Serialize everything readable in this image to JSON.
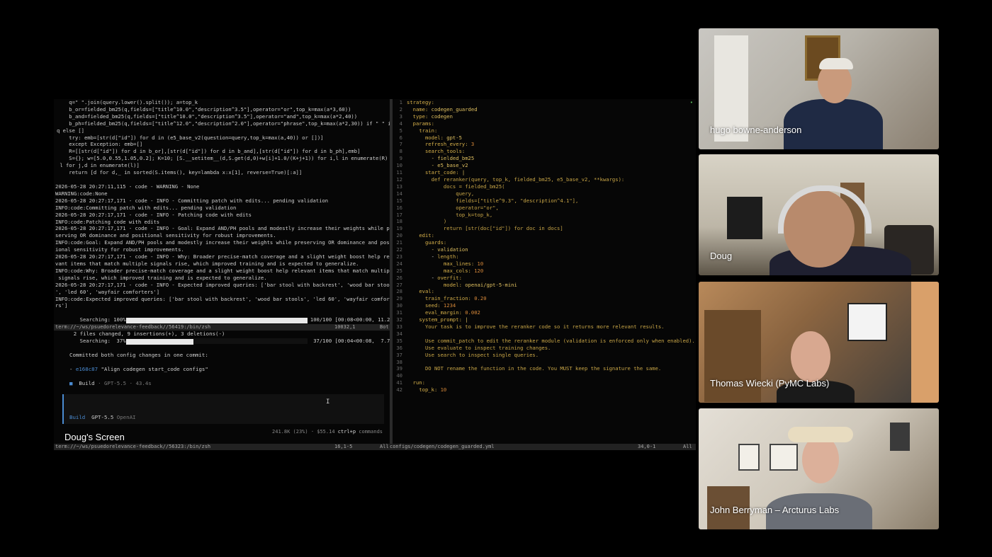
{
  "caption": "Doug's Screen",
  "left_code": [
    "    q=\" \".join(query.lower().split()); a=top_k",
    "    b_or=fielded_bm25(q,fields=[\"title^10.0\",\"description^3.5\"],operator=\"or\",top_k=max(a*3,60))",
    "    b_and=fielded_bm25(q,fields=[\"title^10.0\",\"description^3.5\"],operator=\"and\",top_k=max(a*2,40))",
    "    b_ph=fielded_bm25(q,fields=[\"title^12.0\",\"description^2.0\"],operator=\"phrase\",top_k=max(a*2,30)) if \" \" in",
    "q else []",
    "    try: emb=[str(d[\"id\"]) for d in (e5_base_v2(question=query,top_k=max(a,40)) or [])]",
    "    except Exception: emb=[]",
    "    R=[[str(d[\"id\"]) for d in b_or],[str(d[\"id\"]) for d in b_and],[str(d[\"id\"]) for d in b_ph],emb]",
    "    S={}; w=[5.0,0.55,1.05,0.2]; K=10; [S.__setitem__(d,S.get(d,0)+w[i]+1.0/(K+j+1)) for i,l in enumerate(R) if",
    " l for j,d in enumerate(l)]",
    "    return [d for d,_ in sorted(S.items(), key=lambda x:x[1], reverse=True)[:a]]"
  ],
  "log_lines": [
    "2026-05-28 20:27:11,115 - code - WARNING - None",
    "WARNING:code:None",
    "2026-05-28 20:27:17,171 - code - INFO - Committing patch with edits... pending validation",
    "INFO:code:Committing patch with edits... pending validation",
    "2026-05-28 20:27:17,171 - code - INFO - Patching code with edits",
    "INFO:code:Patching code with edits",
    "2026-05-28 20:27:17,171 - code - INFO - Goal: Expand AND/PH pools and modestly increase their weights while pre",
    "serving OR dominance and positional sensitivity for robust improvements.",
    "INFO:code:Goal: Expand AND/PH pools and modestly increase their weights while preserving OR dominance and posit",
    "ional sensitivity for robust improvements.",
    "2026-05-28 20:27:17,171 - code - INFO - Why: Broader precise-match coverage and a slight weight boost help rele",
    "vant items that match multiple signals rise, which improved training and is expected to generalize.",
    "INFO:code:Why: Broader precise-match coverage and a slight weight boost help relevant items that match multiple",
    " signals rise, which improved training and is expected to generalize.",
    "2026-05-28 20:27:17,171 - code - INFO - Expected improved queries: ['bar stool with backrest', 'wood bar stools",
    "', 'led 60', 'wayfair comforters']",
    "INFO:code:Expected improved queries: ['bar stool with backrest', 'wood bar stools', 'led 60', 'wayfair comforte",
    "rs']"
  ],
  "progress": [
    {
      "label": "Searching: 100%",
      "fraction": 1.0,
      "stats": "100/100 [00:08<00:00, 11.26it/s]"
    },
    {
      "label": "Searching:  37%",
      "fraction": 0.37,
      "stats": " 37/100 [00:04<00:08,  7.73it/s]"
    }
  ],
  "tmux_status": {
    "path": "term://~/ws/psuedorelevance-feedback//56419:/bin/zsh",
    "pos": "10032,1",
    "scroll": "Bot"
  },
  "opencode": {
    "files_changed": "    2 files changed, 9 insertions(+), 3 deletions(-)",
    "commit_msg": "Committed both config changes in one commit:",
    "commit_hash": "e168c87",
    "commit_title": "\"Align codegen start_code configs\"",
    "build_label": "Build",
    "build_model": "GPT-5.5",
    "build_time": "43.4s",
    "input_mode": "Build",
    "input_model": "GPT-5.5",
    "input_provider": "OpenAI",
    "stats": "241.8K (23%) · $55.14",
    "shortcut_key": "ctrl+p",
    "shortcut_label": "commands"
  },
  "bottom_status": {
    "left_path": "term://~/ws/psuedorelevance-feedback//56323:/bin/zsh",
    "left_pos": "16,1-5",
    "left_scroll": "All",
    "right_file": "configs/codegen/codegen_guarded.yml",
    "right_pos": "34,0-1",
    "right_scroll": "All"
  },
  "yaml_lines": [
    {
      "n": "1",
      "t": "strategy:"
    },
    {
      "n": "2",
      "t": "  name: codegen_guarded"
    },
    {
      "n": "3",
      "t": "  type: codegen"
    },
    {
      "n": "4",
      "t": "  params:"
    },
    {
      "n": "5",
      "t": "    train:"
    },
    {
      "n": "6",
      "t": "      model: gpt-5"
    },
    {
      "n": "7",
      "t": "      refresh_every: 3"
    },
    {
      "n": "8",
      "t": "      search_tools:"
    },
    {
      "n": "9",
      "t": "        - fielded_bm25"
    },
    {
      "n": "10",
      "t": "        - e5_base_v2"
    },
    {
      "n": "11",
      "t": "      start_code: |"
    },
    {
      "n": "12",
      "t": "        def reranker(query, top_k, fielded_bm25, e5_base_v2, **kwargs):"
    },
    {
      "n": "13",
      "t": "            docs = fielded_bm25("
    },
    {
      "n": "14",
      "t": "                query,"
    },
    {
      "n": "15",
      "t": "                fields=[\"title^9.3\", \"description^4.1\"],"
    },
    {
      "n": "16",
      "t": "                operator=\"or\","
    },
    {
      "n": "17",
      "t": "                top_k=top_k,"
    },
    {
      "n": "18",
      "t": "            )"
    },
    {
      "n": "19",
      "t": "            return [str(doc[\"id\"]) for doc in docs]"
    },
    {
      "n": "20",
      "t": "    edit:"
    },
    {
      "n": "21",
      "t": "      guards:"
    },
    {
      "n": "22",
      "t": "        - validation"
    },
    {
      "n": "23",
      "t": "        - length:"
    },
    {
      "n": "24",
      "t": "            max_lines: 10"
    },
    {
      "n": "25",
      "t": "            max_cols: 120"
    },
    {
      "n": "26",
      "t": "        - overfit:"
    },
    {
      "n": "27",
      "t": "            model: openai/gpt-5-mini"
    },
    {
      "n": "28",
      "t": "    eval:"
    },
    {
      "n": "29",
      "t": "      train_fraction: 0.20"
    },
    {
      "n": "30",
      "t": "      seed: 1234"
    },
    {
      "n": "31",
      "t": "      eval_margin: 0.002"
    },
    {
      "n": "32",
      "t": "    system_prompt: |"
    },
    {
      "n": "33",
      "t": "      Your task is to improve the reranker code so it returns more relevant results."
    },
    {
      "n": "34",
      "t": ""
    },
    {
      "n": "35",
      "t": "      Use commit_patch to edit the reranker module (validation is enforced only when enabled)."
    },
    {
      "n": "36",
      "t": "      Use evaluate to inspect training changes."
    },
    {
      "n": "37",
      "t": "      Use search to inspect single queries."
    },
    {
      "n": "38",
      "t": ""
    },
    {
      "n": "39",
      "t": "      DO NOT rename the function in the code. You MUST keep the signature the same."
    },
    {
      "n": "40",
      "t": ""
    },
    {
      "n": "41",
      "t": "  run:"
    },
    {
      "n": "42",
      "t": "    top_k: 10"
    }
  ],
  "participants": [
    {
      "name": "hugo bowne-anderson"
    },
    {
      "name": "Doug"
    },
    {
      "name": "Thomas Wiecki (PyMC Labs)"
    },
    {
      "name": "John Berryman – Arcturus Labs"
    }
  ],
  "colors": {
    "accent": "#4a8bd1",
    "yaml_key": "#d6b04a",
    "yaml_num": "#d98a3a"
  },
  "icons": [
    "text-cursor-icon",
    "status-dot-icon",
    "build-square-icon"
  ]
}
